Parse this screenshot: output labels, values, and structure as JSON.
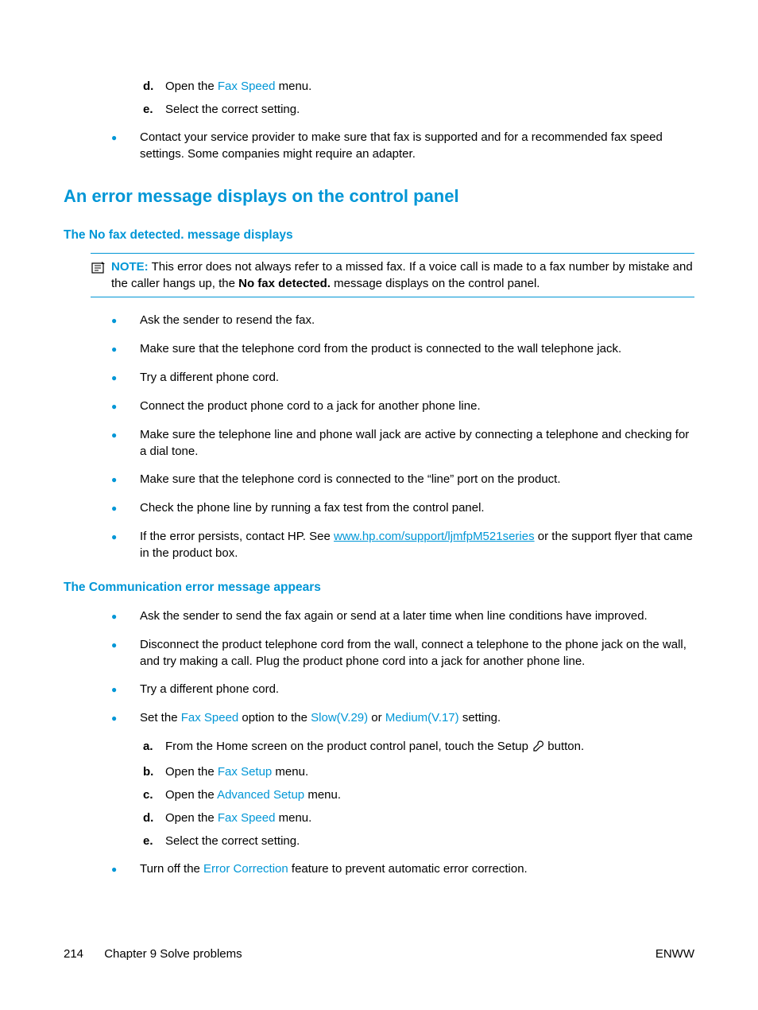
{
  "top_steps": {
    "d": {
      "pre": "Open the ",
      "term": "Fax Speed",
      "post": " menu."
    },
    "e": "Select the correct setting."
  },
  "top_bullet": "Contact your service provider to make sure that fax is supported and for a recommended fax speed settings. Some companies might require an adapter.",
  "h2": "An error message displays on the control panel",
  "sec1": {
    "h3": "The No fax detected. message displays",
    "note": {
      "label": "NOTE:",
      "t1": "This error does not always refer to a missed fax. If a voice call is made to a fax number by mistake and the caller hangs up, the ",
      "bold": "No fax detected.",
      "t2": " message displays on the control panel."
    },
    "b1": "Ask the sender to resend the fax.",
    "b2": "Make sure that the telephone cord from the product is connected to the wall telephone jack.",
    "b3": "Try a different phone cord.",
    "b4": "Connect the product phone cord to a jack for another phone line.",
    "b5": "Make sure the telephone line and phone wall jack are active by connecting a telephone and checking for a dial tone.",
    "b6": "Make sure that the telephone cord is connected to the “line” port on the product.",
    "b7": "Check the phone line by running a fax test from the control panel.",
    "b8": {
      "pre": "If the error persists, contact HP. See ",
      "link": "www.hp.com/support/ljmfpM521series",
      "post": " or the support flyer that came in the product box."
    }
  },
  "sec2": {
    "h3": "The Communication error message appears",
    "b1": "Ask the sender to send the fax again or send at a later time when line conditions have improved.",
    "b2": "Disconnect the product telephone cord from the wall, connect a telephone to the phone jack on the wall, and try making a call. Plug the product phone cord into a jack for another phone line.",
    "b3": "Try a different phone cord.",
    "b4": {
      "t1": "Set the ",
      "u1": "Fax Speed",
      "t2": " option to the ",
      "u2": "Slow(V.29)",
      "t3": " or ",
      "u3": "Medium(V.17)",
      "t4": " setting."
    },
    "steps": {
      "a": {
        "pre": "From the Home screen on the product control panel, touch the Setup ",
        "post": " button."
      },
      "b": {
        "pre": "Open the ",
        "term": "Fax Setup",
        "post": " menu."
      },
      "c": {
        "pre": "Open the ",
        "term": "Advanced Setup",
        "post": " menu."
      },
      "d": {
        "pre": "Open the ",
        "term": "Fax Speed",
        "post": " menu."
      },
      "e": "Select the correct setting."
    },
    "b5": {
      "t1": "Turn off the ",
      "u": "Error Correction",
      "t2": " feature to prevent automatic error correction."
    }
  },
  "footer": {
    "page": "214",
    "chapter": "Chapter 9   Solve problems",
    "right": "ENWW"
  }
}
